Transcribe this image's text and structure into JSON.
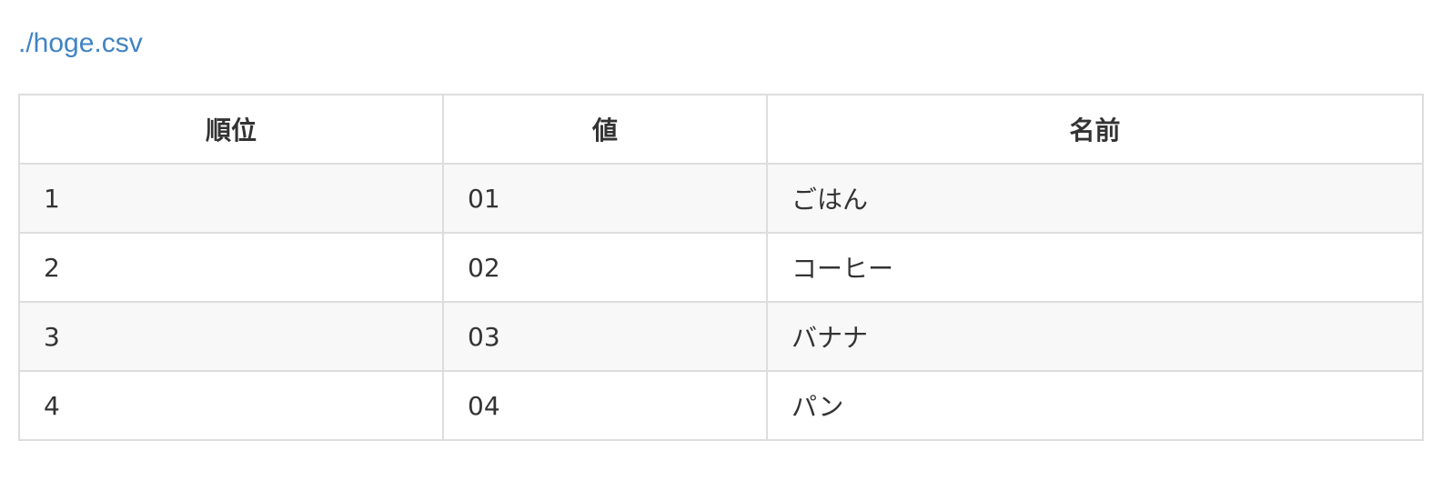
{
  "file": {
    "link_text": "./hoge.csv"
  },
  "table": {
    "headers": [
      "順位",
      "値",
      "名前"
    ],
    "rows": [
      [
        "1",
        "01",
        "ごはん"
      ],
      [
        "2",
        "02",
        "コーヒー"
      ],
      [
        "3",
        "03",
        "バナナ"
      ],
      [
        "4",
        "04",
        "パン"
      ]
    ]
  }
}
